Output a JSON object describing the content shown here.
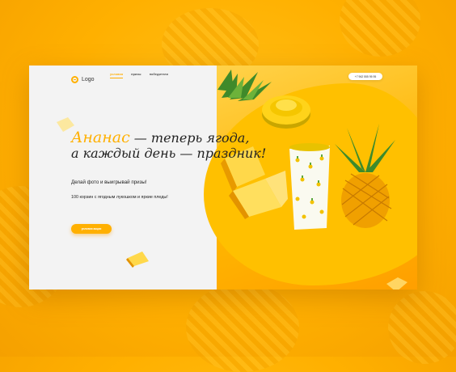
{
  "header": {
    "logo_text": "Logo",
    "nav": [
      {
        "label": "условия",
        "active": true
      },
      {
        "label": "призы",
        "active": false
      },
      {
        "label": "победители",
        "active": false
      }
    ],
    "phone": "+7 962 555 95 95"
  },
  "hero": {
    "title_highlight": "Ананас",
    "title_line1_rest": " — теперь ягода,",
    "title_line2": "а каждый день — праздник!",
    "subtitle": "Делай фото и выигрывай призы!",
    "description": "100 корзин с ягодным лукошком и яркие пледы!",
    "cta_label": "условия акции"
  },
  "colors": {
    "accent": "#ffb000",
    "background": "#f3f3f3",
    "text": "#222222"
  },
  "icons": {
    "logo": "logo-icon",
    "scroll": "scroll-down-icon"
  }
}
